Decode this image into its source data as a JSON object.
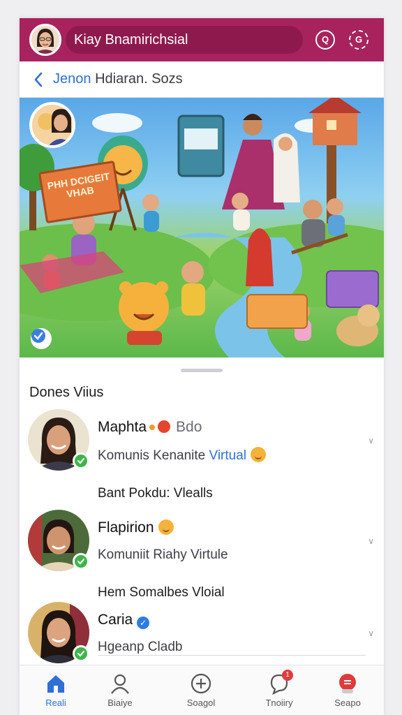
{
  "header": {
    "title": "Kiay Bnamirichsial",
    "accent_color": "#a8225d",
    "icons": [
      "chat-icon",
      "refresh-icon"
    ]
  },
  "breadcrumb": {
    "prefix": "Jenon",
    "text": "Hdiaran. Sozs"
  },
  "hero": {
    "sign_text": "PHH DCIGEIT VHAB"
  },
  "section": {
    "title": "Dones Viius"
  },
  "contacts": [
    {
      "name": "Maphta",
      "extra": "Bdo",
      "subtitle": "Komunis Kenanite",
      "subtitle_highlight": "Virtual"
    },
    {
      "name": "Flapirion",
      "subtitle": "Komuniit Riahy Virtule"
    },
    {
      "name": "Caria",
      "subtitle": "Hgeanp Cladb"
    }
  ],
  "group_labels": [
    "Bant Pokdu: Vlealls",
    "Hem Somalbes Vloial"
  ],
  "bottom_nav": [
    {
      "label": "Reali",
      "icon": "home-icon",
      "active": true
    },
    {
      "label": "Biaiye",
      "icon": "profile-icon",
      "active": false
    },
    {
      "label": "Soagol",
      "icon": "add-icon",
      "active": false
    },
    {
      "label": "Tnoiiry",
      "icon": "notification-icon",
      "active": false,
      "badge": "1"
    },
    {
      "label": "Seapo",
      "icon": "shop-icon",
      "active": false
    }
  ]
}
